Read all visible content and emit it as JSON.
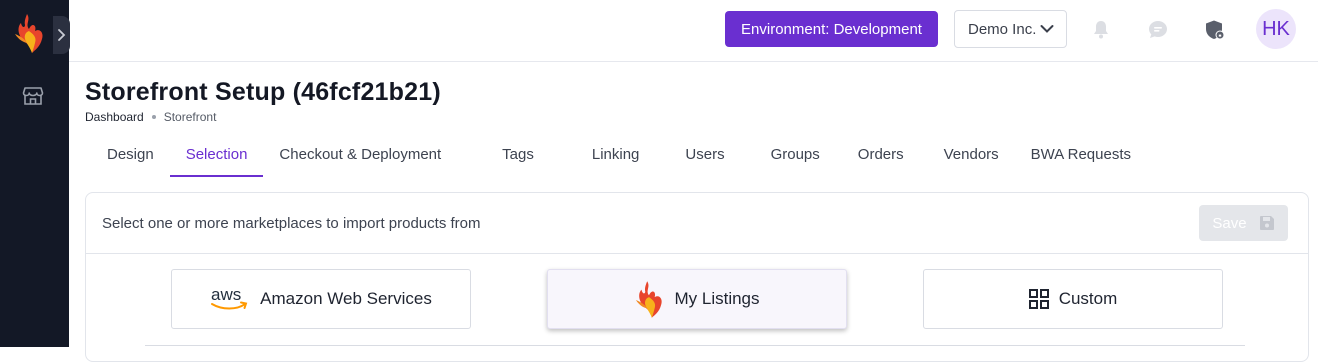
{
  "header": {
    "environment_label": "Environment: Development",
    "org_name": "Demo Inc.",
    "avatar_initials": "HK",
    "icons": [
      "bell-icon",
      "chat-icon",
      "shield-lock-icon"
    ]
  },
  "sidebar": {
    "items": [
      {
        "icon": "storefront-icon"
      }
    ]
  },
  "page": {
    "title": "Storefront Setup (46fcf21b21)",
    "breadcrumb": {
      "root": "Dashboard",
      "current": "Storefront"
    }
  },
  "tabs": [
    {
      "label": "Design",
      "active": false
    },
    {
      "label": "Selection",
      "active": true
    },
    {
      "label": "Checkout & Deployment",
      "active": false
    },
    {
      "label": "Tags",
      "active": false
    },
    {
      "label": "Linking",
      "active": false
    },
    {
      "label": "Users",
      "active": false
    },
    {
      "label": "Groups",
      "active": false
    },
    {
      "label": "Orders",
      "active": false
    },
    {
      "label": "Vendors",
      "active": false
    },
    {
      "label": "BWA Requests",
      "active": false
    }
  ],
  "panel": {
    "instructions": "Select one or more marketplaces to import products from",
    "save_label": "Save",
    "marketplaces": [
      {
        "label": "Amazon Web Services",
        "icon": "aws-logo-icon",
        "selected": false
      },
      {
        "label": "My Listings",
        "icon": "flame-logo-icon",
        "selected": true
      },
      {
        "label": "Custom",
        "icon": "grid-icon",
        "selected": false
      }
    ]
  },
  "colors": {
    "accent": "#6a2fd0",
    "sidebar_bg": "#131826",
    "avatar_bg": "#ece4fb",
    "save_disabled_bg": "#e4e6ea"
  }
}
